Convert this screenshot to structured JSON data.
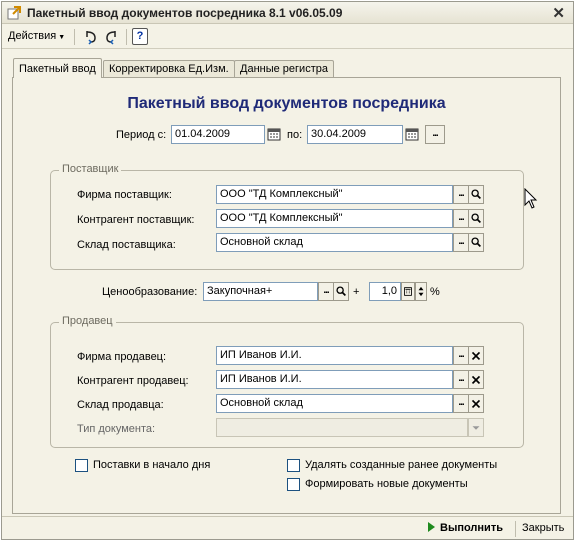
{
  "window": {
    "title": "Пакетный ввод документов посредника 8.1 v06.05.09",
    "close_glyph": "✕"
  },
  "toolbar": {
    "actions_label": "Действия",
    "help_label": "?"
  },
  "tabs": [
    {
      "label": "Пакетный ввод"
    },
    {
      "label": "Корректировка Ед.Изм."
    },
    {
      "label": "Данные регистра"
    }
  ],
  "form": {
    "heading": "Пакетный ввод документов посредника",
    "period": {
      "from_label": "Период с:",
      "from_value": "01.04.2009",
      "to_label": "по:",
      "to_value": "30.04.2009",
      "dots": "..."
    },
    "supplier": {
      "title": "Поставщик",
      "firm_label": "Фирма поставщик:",
      "firm_value": "ООО \"ТД Комплексный\"",
      "counterparty_label": "Контрагент поставщик:",
      "counterparty_value": "ООО \"ТД Комплексный\"",
      "warehouse_label": "Склад поставщика:",
      "warehouse_value": "Основной склад"
    },
    "pricing": {
      "label": "Ценообразование:",
      "value": "Закупочная+",
      "plus": "+",
      "markup": "1,0",
      "percent": "%"
    },
    "seller": {
      "title": "Продавец",
      "firm_label": "Фирма продавец:",
      "firm_value": "ИП Иванов И.И.",
      "counterparty_label": "Контрагент продавец:",
      "counterparty_value": "ИП Иванов И.И.",
      "warehouse_label": "Склад продавца:",
      "warehouse_value": "Основной склад",
      "doctype_label": "Тип документа:",
      "doctype_value": ""
    },
    "options": {
      "deliveries_start": "Поставки в начало дня",
      "delete_created": "Удалять созданные ранее документы",
      "form_new": "Формировать новые документы"
    }
  },
  "footer": {
    "run_label": "Выполнить",
    "close_label": "Закрыть"
  },
  "colors": {
    "heading": "#1f2a78",
    "accent_play": "#1e8a1e"
  }
}
